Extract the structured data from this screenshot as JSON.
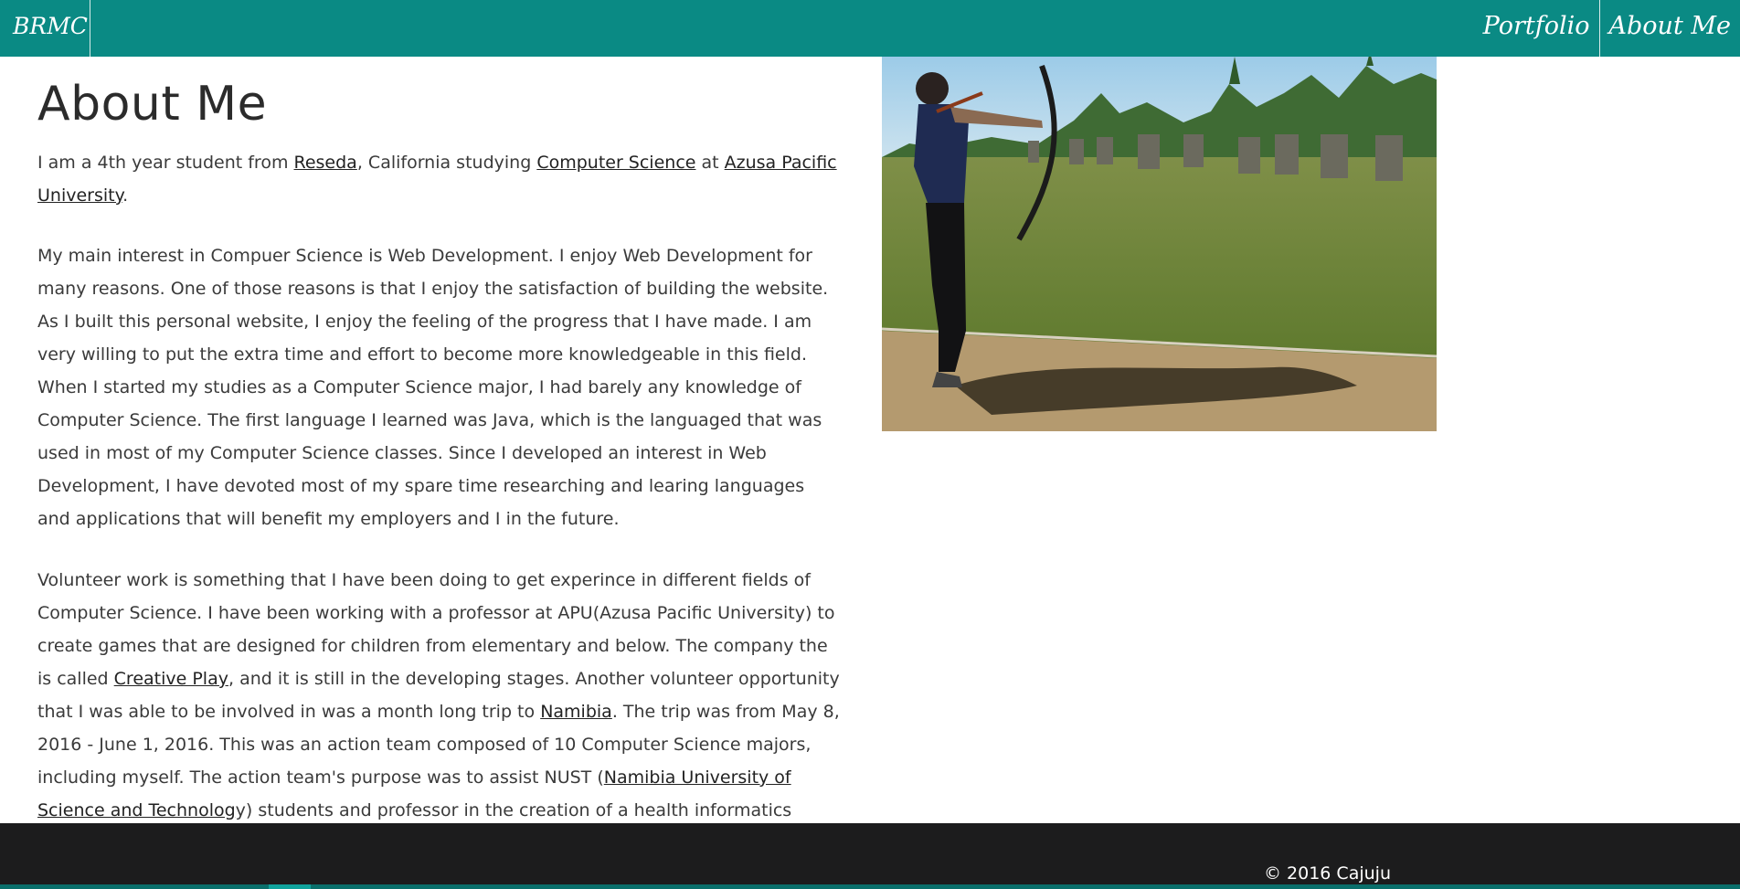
{
  "nav": {
    "brand": "BRMC",
    "links": [
      "Portfolio",
      "About Me"
    ]
  },
  "page": {
    "title": "About Me"
  },
  "paragraph1": {
    "t1": "I am a 4th year student from ",
    "link_reseda": "Reseda",
    "t2": ", California studying ",
    "link_cs": "Computer Science",
    "t3": " at ",
    "link_apu": "Azusa Pacific University",
    "t4": "."
  },
  "paragraph2": {
    "text": "My main interest in Compuer Science is Web Development. I enjoy Web Development for many reasons. One of those reasons is that I enjoy the satisfaction of building the website. As I built this personal website, I enjoy the feeling of the progress that I have made. I am very willing to put the extra time and effort to become more knowledgeable in this field. When I started my studies as a Computer Science major, I had barely any knowledge of Computer Science. The first language I learned was Java, which is the languaged that was used in most of my Computer Science classes. Since I developed an interest in Web Development, I have devoted most of my spare time researching and learing languages and applications that will benefit my employers and I in the future."
  },
  "paragraph3": {
    "t1": "Volunteer work is something that I have been doing to get experince in different fields of Computer Science. I have been working with a professor at APU(Azusa Pacific University) to create games that are designed for children from elementary and below. The company the is called ",
    "link_creative_play": "Creative Play",
    "t2": ", and it is still in the developing stages. Another volunteer opportunity that I was able to be involved in was a month long trip to ",
    "link_namibia": "Namibia",
    "t3": ". The trip was from May 8, 2016 - June 1, 2016. This was an action team composed of 10 Computer Science majors, including myself. The action team's purpose was to assist NUST (",
    "link_nust": "Namibia University of Science and Technolog",
    "t4": "y) students and professor in the creation of a health informatics system for public and private hospitals to use."
  },
  "footer": {
    "copyright": "© 2016 Cajuju"
  },
  "colors": {
    "navbar": "#0a8a84",
    "footer": "#1c1c1d"
  }
}
